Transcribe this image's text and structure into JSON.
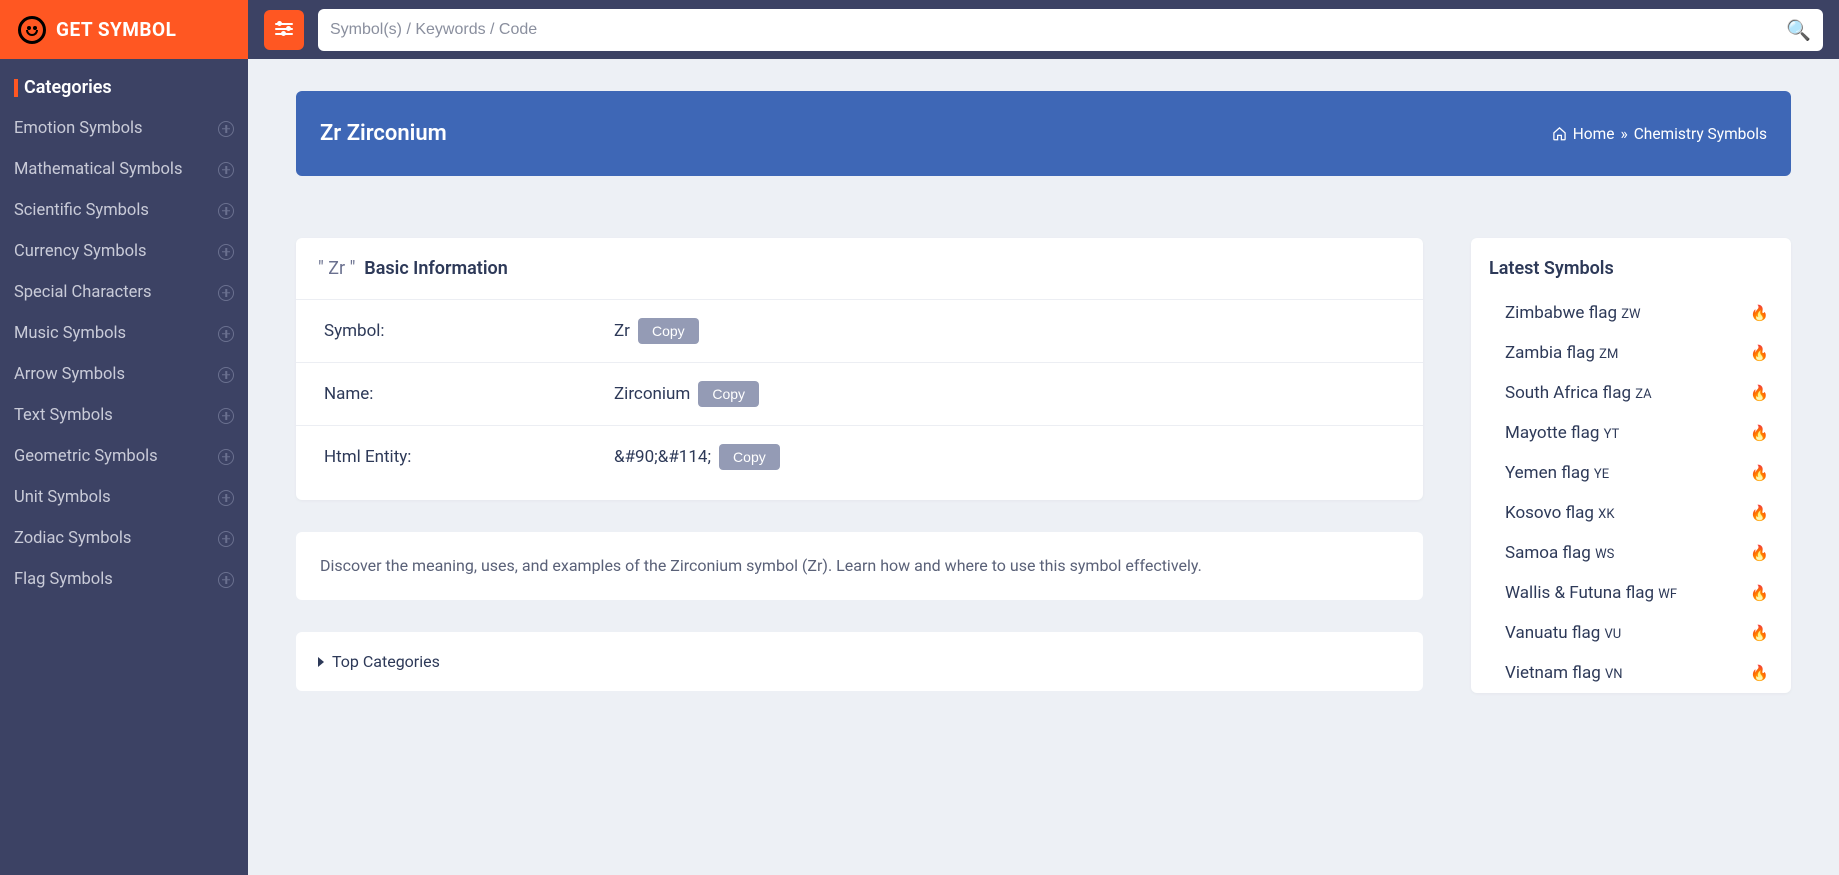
{
  "brand": "GET SYMBOL",
  "sidebar": {
    "header": "Categories",
    "items": [
      "Emotion Symbols",
      "Mathematical Symbols",
      "Scientific Symbols",
      "Currency Symbols",
      "Special Characters",
      "Music Symbols",
      "Arrow Symbols",
      "Text Symbols",
      "Geometric Symbols",
      "Unit Symbols",
      "Zodiac Symbols",
      "Flag Symbols"
    ]
  },
  "search": {
    "placeholder": "Symbol(s) / Keywords / Code"
  },
  "page": {
    "title": "Zr Zirconium",
    "breadcrumb": {
      "home": "Home",
      "sep": "»",
      "current": "Chemistry Symbols"
    }
  },
  "info": {
    "symbol_quoted": "\" Zr \"",
    "heading": "Basic Information",
    "rows": [
      {
        "label": "Symbol:",
        "value": "Zr"
      },
      {
        "label": "Name:",
        "value": "Zirconium"
      },
      {
        "label": "Html Entity:",
        "value": "&#90;&#114;"
      }
    ],
    "copy_label": "Copy"
  },
  "description": "Discover the meaning, uses, and examples of the Zirconium symbol (Zr). Learn how and where to use this symbol effectively.",
  "top_categories_label": "Top Categories",
  "latest": {
    "heading": "Latest Symbols",
    "items": [
      {
        "label": "Zimbabwe flag",
        "suffix": "ZW"
      },
      {
        "label": "Zambia flag",
        "suffix": "ZM"
      },
      {
        "label": "South Africa flag",
        "suffix": "ZA"
      },
      {
        "label": "Mayotte flag",
        "suffix": "YT"
      },
      {
        "label": "Yemen flag",
        "suffix": "YE"
      },
      {
        "label": "Kosovo flag",
        "suffix": "XK"
      },
      {
        "label": "Samoa flag",
        "suffix": "WS"
      },
      {
        "label": "Wallis & Futuna flag",
        "suffix": "WF"
      },
      {
        "label": "Vanuatu flag",
        "suffix": "VU"
      },
      {
        "label": "Vietnam flag",
        "suffix": "VN"
      }
    ]
  }
}
